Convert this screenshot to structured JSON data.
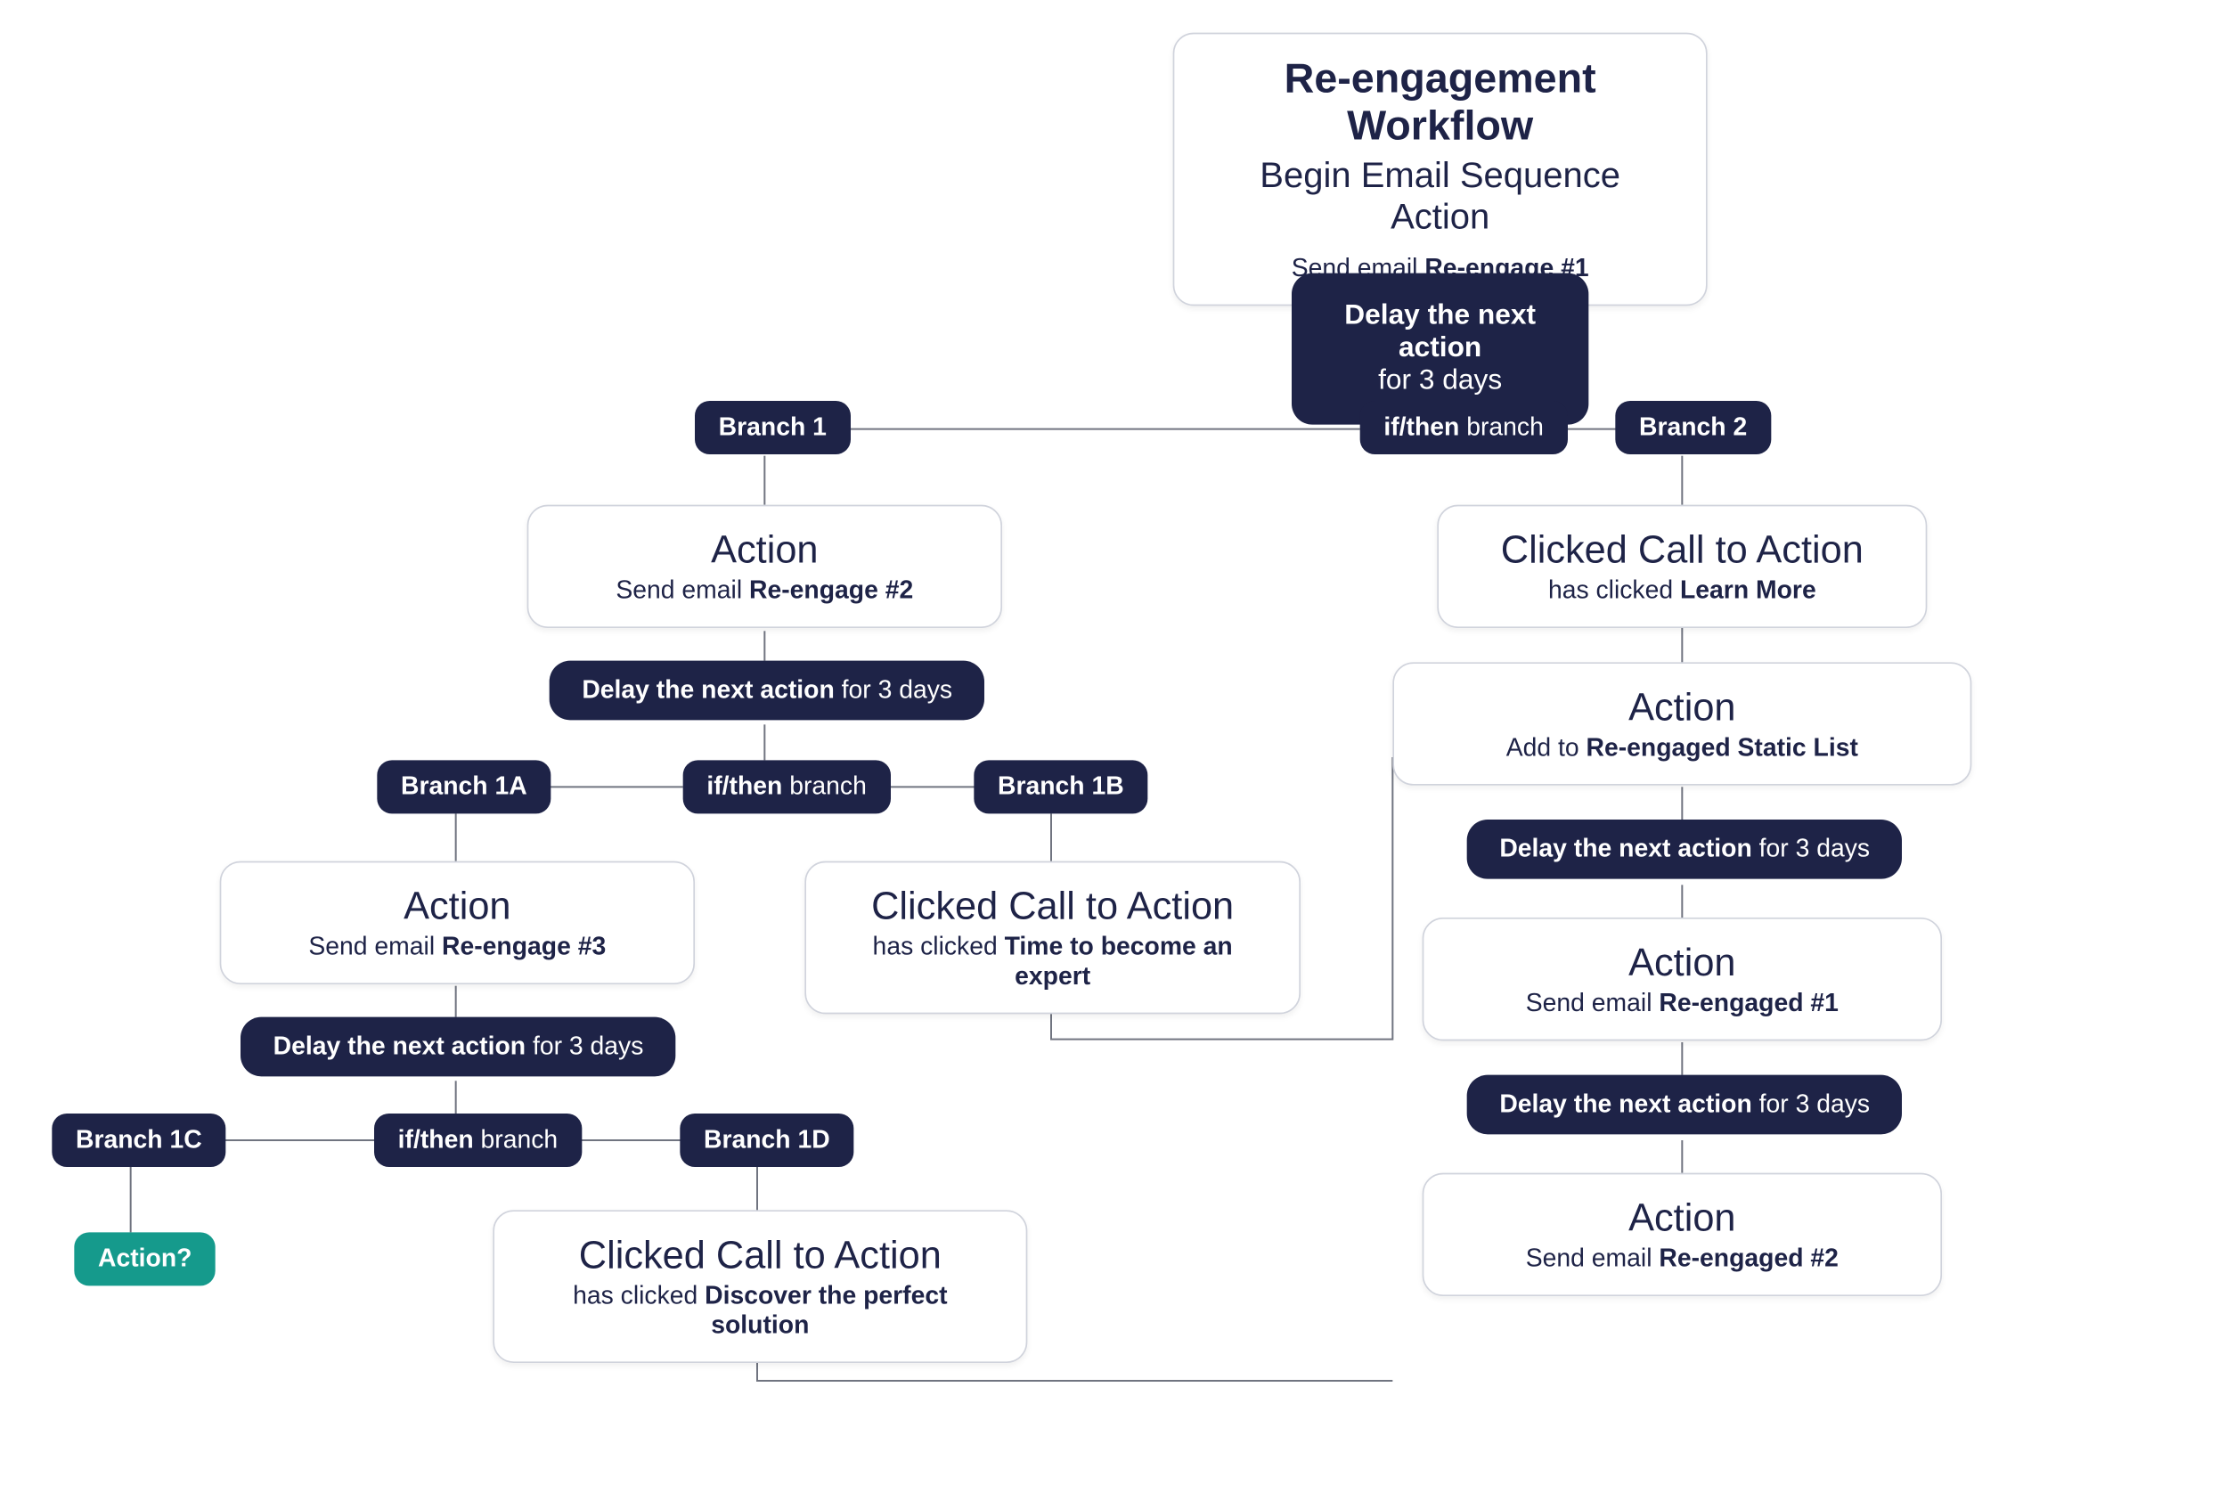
{
  "start": {
    "title": "Re-engagement Workflow",
    "subtitle": "Begin Email Sequence Action",
    "detail_prefix": "Send email ",
    "detail_bold": "Re-engage #1"
  },
  "delay_top": {
    "bold": "Delay the next action",
    "plain": "for 3 days"
  },
  "split_top": {
    "if_bold": "if/then",
    "if_plain": " branch",
    "left": "Branch 1",
    "right": "Branch 2"
  },
  "b1_action": {
    "title": "Action",
    "prefix": "Send email ",
    "bold": "Re-engage #2"
  },
  "b1_delay": {
    "bold": "Delay the next action",
    "plain": " for 3 days"
  },
  "b1_split": {
    "if_bold": "if/then",
    "if_plain": " branch",
    "left": "Branch 1A",
    "right": "Branch 1B"
  },
  "b1a_action": {
    "title": "Action",
    "prefix": "Send email ",
    "bold": "Re-engage #3"
  },
  "b1a_delay": {
    "bold": "Delay the next action",
    "plain": " for 3 days"
  },
  "b1a_split": {
    "if_bold": "if/then",
    "if_plain": " branch",
    "left": "Branch 1C",
    "right": "Branch 1D"
  },
  "b1c_action": "Action?",
  "b1d_node": {
    "title": "Clicked Call to Action",
    "prefix": "has clicked ",
    "bold": "Discover the perfect solution"
  },
  "b1b_node": {
    "title": "Clicked Call to Action",
    "prefix": "has clicked ",
    "bold": "Time to become an expert"
  },
  "b2_node": {
    "title": "Clicked Call to Action",
    "prefix": "has clicked ",
    "bold": "Learn More"
  },
  "b2_action1": {
    "title": "Action",
    "prefix": "Add to ",
    "bold": "Re-engaged Static List"
  },
  "b2_delay1": {
    "bold": "Delay the next action",
    "plain": " for 3 days"
  },
  "b2_action2": {
    "title": "Action",
    "prefix": "Send email ",
    "bold": "Re-engaged #1"
  },
  "b2_delay2": {
    "bold": "Delay the next action",
    "plain": " for 3 days"
  },
  "b2_action3": {
    "title": "Action",
    "prefix": "Send email ",
    "bold": "Re-engaged #2"
  }
}
